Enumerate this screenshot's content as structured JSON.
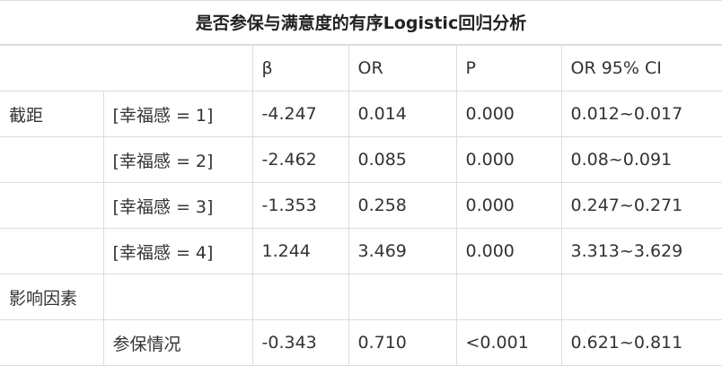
{
  "title": "是否参保与满意度的有序Logistic回归分析",
  "header": [
    "",
    "",
    "β",
    "OR",
    "P",
    "OR 95% CI"
  ],
  "rows": [
    [
      "截距",
      "[幸福感 = 1]",
      "-4.247",
      "0.014",
      "0.000",
      "0.012~0.017"
    ],
    [
      "",
      "[幸福感 = 2]",
      "-2.462",
      "0.085",
      "0.000",
      "0.08~0.091"
    ],
    [
      "",
      "[幸福感 = 3]",
      "-1.353",
      "0.258",
      "0.000",
      "0.247~0.271"
    ],
    [
      "",
      "[幸福感 = 4]",
      "1.244",
      "3.469",
      "0.000",
      "3.313~3.629"
    ],
    [
      "影响因素",
      "",
      "",
      "",
      "",
      ""
    ],
    [
      "",
      "参保情况",
      "-0.343",
      "0.710",
      "<0.001",
      "0.621~0.811"
    ]
  ]
}
